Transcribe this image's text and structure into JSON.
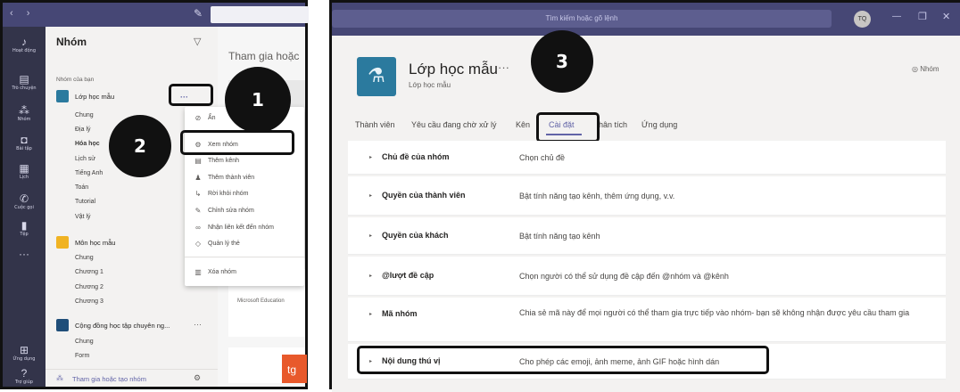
{
  "left": {
    "rail": [
      {
        "label": "Hoạt động",
        "icon": "bell-icon"
      },
      {
        "label": "Trò chuyện",
        "icon": "chat-icon"
      },
      {
        "label": "Nhóm",
        "icon": "teams-icon"
      },
      {
        "label": "Bài tập",
        "icon": "assignments-icon"
      },
      {
        "label": "Lịch",
        "icon": "calendar-icon"
      },
      {
        "label": "Cuộc gọi",
        "icon": "phone-icon"
      },
      {
        "label": "Tệp",
        "icon": "file-icon"
      },
      {
        "label": "Ứng dụng",
        "icon": "apps-icon"
      },
      {
        "label": "Trợ giúp",
        "icon": "help-icon"
      }
    ],
    "teams_title": "Nhóm",
    "your_teams": "Nhóm của bạn",
    "team1": {
      "name": "Lớp học mẫu",
      "more": "···",
      "channels": [
        "Chung",
        "Địa lý",
        "Hóa học",
        "Lịch sử",
        "Tiếng Anh",
        "Toán",
        "Tutorial",
        "Vật lý"
      ]
    },
    "team2": {
      "name": "Môn học mẫu",
      "channels": [
        "Chung",
        "Chương 1",
        "Chương 2",
        "Chương 3"
      ]
    },
    "team3": {
      "name": "Cộng đồng học tập chuyên ng...",
      "more": "···",
      "channels": [
        "Chung",
        "Form"
      ]
    },
    "join_create": "Tham gia hoặc tạo nhóm",
    "main_heading": "Tham gia hoặc",
    "ms_education": "Microsoft Education",
    "tile_initials": "tg",
    "menu": [
      {
        "label": "Ẩn",
        "icon": "hide-icon"
      },
      {
        "label": "Xem nhóm",
        "icon": "gear-icon"
      },
      {
        "label": "Thêm kênh",
        "icon": "add-channel-icon"
      },
      {
        "label": "Thêm thành viên",
        "icon": "add-member-icon"
      },
      {
        "label": "Rời khỏi nhóm",
        "icon": "leave-icon"
      },
      {
        "label": "Chỉnh sửa nhóm",
        "icon": "pencil-icon"
      },
      {
        "label": "Nhận liên kết đến nhóm",
        "icon": "link-icon"
      },
      {
        "label": "Quản lý thẻ",
        "icon": "tag-icon"
      },
      {
        "label": "Xóa nhóm",
        "icon": "trash-icon"
      }
    ],
    "callouts": [
      "1",
      "2"
    ]
  },
  "right": {
    "search_placeholder": "Tìm kiếm hoặc gõ lệnh",
    "avatar": "TQ",
    "team_name": "Lớp học mẫu",
    "team_more": "···",
    "team_subtitle": "Lớp học mẫu",
    "team_badge": "Nhóm",
    "callout": "3",
    "tabs": [
      "Thành viên",
      "Yêu cầu đang chờ xử lý",
      "Kênh",
      "Cài đặt",
      "Phân tích",
      "Ứng dụng"
    ],
    "tab_visible": [
      "Thành viên",
      "Yêu cầu đang chờ xử lý",
      "Kên",
      "Cài đặt",
      "hân tích",
      "Ứng dụng"
    ],
    "settings": [
      {
        "key": "Chủ đề của nhóm",
        "value": "Chọn chủ đề"
      },
      {
        "key": "Quyền của thành viên",
        "value": "Bật tính năng tạo kênh, thêm ứng dụng, v.v."
      },
      {
        "key": "Quyền của khách",
        "value": "Bật tính năng tạo kênh"
      },
      {
        "key": "@lượt đề cập",
        "value": "Chọn người có thể sử dụng đề cập đến @nhóm và @kênh"
      },
      {
        "key": "Mã nhóm",
        "value": "Chia sẻ mã này để mọi người có thể tham gia trực tiếp vào nhóm- bạn sẽ không nhận được yêu cầu tham gia"
      },
      {
        "key": "Nội dung thú vị",
        "value": "Cho phép các emoji, ảnh meme, ảnh GIF hoặc hình dán"
      }
    ]
  },
  "colors": {
    "rail": "#33344a",
    "titlebar": "#464775",
    "accent": "#6264a7",
    "highlight": "#111111"
  }
}
